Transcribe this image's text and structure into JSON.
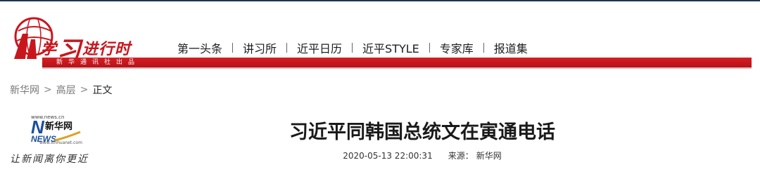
{
  "header": {
    "logo_char": "学",
    "logo_char_big": "习",
    "logo_rest": "进行时",
    "bar_text": "新华通讯社出品",
    "nav": [
      {
        "label": "第一头条"
      },
      {
        "label": "讲习所"
      },
      {
        "label": "近平日历"
      },
      {
        "label": "近平STYLE"
      },
      {
        "label": "专家库"
      },
      {
        "label": "报道集"
      }
    ]
  },
  "breadcrumb": {
    "items": [
      "新华网",
      "高层",
      "正文"
    ],
    "separator": ">"
  },
  "site_logo": {
    "url_top": "www.news.cn",
    "name": "新华网",
    "brand_letters": "NEWS",
    "url_bottom": "www.xinhuanet.com",
    "slogan": "让新闻离你更近"
  },
  "article": {
    "title": "习近平同韩国总统文在寅通电话",
    "datetime": "2020-05-13 22:00:31",
    "source_label": "来源：",
    "source_name": "新华网"
  },
  "colors": {
    "brand_red": "#c8161d",
    "top_line": "#1f3550"
  }
}
